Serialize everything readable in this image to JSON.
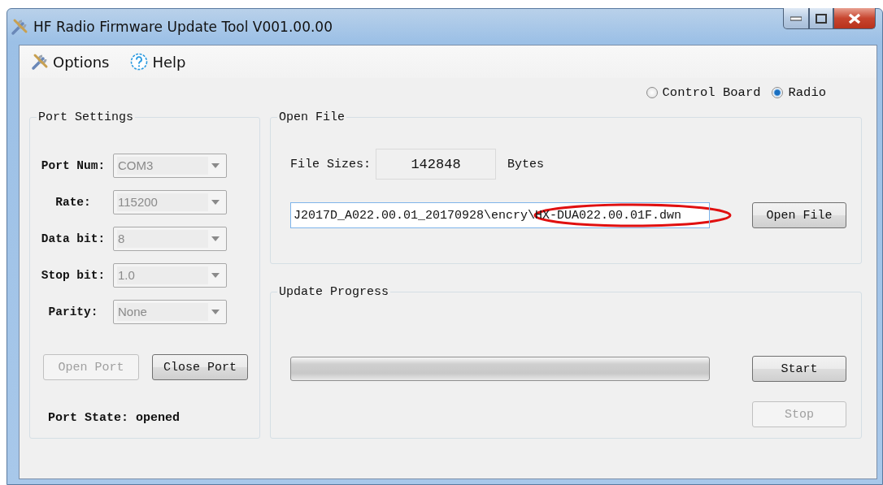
{
  "window": {
    "title": "HF Radio Firmware Update Tool V001.00.00"
  },
  "menu": [
    {
      "kind": "options",
      "label": "Options"
    },
    {
      "kind": "help",
      "label": "Help"
    }
  ],
  "target_options": [
    {
      "label": "Control Board",
      "selected": false
    },
    {
      "label": "Radio",
      "selected": true
    }
  ],
  "port_settings": {
    "title": "Port Settings",
    "fields": [
      {
        "label": "Port Num:",
        "value": "COM3",
        "disabled": true
      },
      {
        "label": "Rate:",
        "value": "115200",
        "disabled": true
      },
      {
        "label": "Data bit:",
        "value": "8",
        "disabled": true
      },
      {
        "label": "Stop bit:",
        "value": "1.0",
        "disabled": true
      },
      {
        "label": "Parity:",
        "value": "None",
        "disabled": true
      }
    ],
    "buttons": [
      {
        "label": "Open Port",
        "disabled": true
      },
      {
        "label": "Close Port",
        "disabled": false
      }
    ],
    "status": "Port State: opened"
  },
  "open_file": {
    "title": "Open File",
    "size_label": "File Sizes:",
    "size_value": "142848",
    "size_unit": "Bytes",
    "path": "J2017D_A022.00.01_20170928\\encry\\HX-DUA022.00.01F.dwn",
    "path_circled": true,
    "button": {
      "label": "Open File",
      "disabled": false
    }
  },
  "update_progress": {
    "title": "Update Progress",
    "level": 0,
    "buttons": [
      {
        "label": "Start",
        "disabled": false
      },
      {
        "label": "Stop",
        "disabled": true
      }
    ]
  }
}
